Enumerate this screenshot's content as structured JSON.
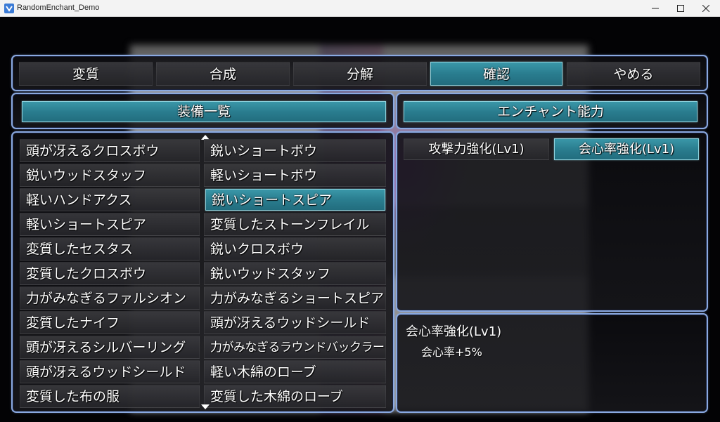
{
  "window": {
    "title": "RandomEnchant_Demo"
  },
  "command_menu": {
    "items": [
      {
        "label": "変質",
        "selected": false
      },
      {
        "label": "合成",
        "selected": false
      },
      {
        "label": "分解",
        "selected": false
      },
      {
        "label": "確認",
        "selected": true
      },
      {
        "label": "やめる",
        "selected": false
      }
    ]
  },
  "equipment_panel": {
    "header": "装備一覧"
  },
  "enchant_panel": {
    "header": "エンチャント能力"
  },
  "equipment_list": {
    "left": [
      "頭が冴えるクロスボウ",
      "鋭いウッドスタッフ",
      "軽いハンドアクス",
      "軽いショートスピア",
      "変質したセスタス",
      "変質したクロスボウ",
      "力がみなぎるファルシオン",
      "変質したナイフ",
      "頭が冴えるシルバーリング",
      "頭が冴えるウッドシールド",
      "変質した布の服"
    ],
    "right": [
      "鋭いショートボウ",
      "軽いショートボウ",
      "鋭いショートスピア",
      "変質したストーンフレイル",
      "鋭いクロスボウ",
      "鋭いウッドスタッフ",
      "力がみなぎるショートスピア",
      "頭が冴えるウッドシールド",
      "力がみなぎるラウンドバックラー",
      "軽い木綿のローブ",
      "変質した木綿のローブ"
    ],
    "selected": "鋭いショートスピア"
  },
  "enchantments": {
    "items": [
      {
        "label": "攻撃力強化(Lv1)",
        "selected": false
      },
      {
        "label": "会心率強化(Lv1)",
        "selected": true
      }
    ]
  },
  "help": {
    "title": "会心率強化(Lv1)",
    "effect": "会心率+5%"
  },
  "colors": {
    "frame_border": "#8aa9e0",
    "selection": "#2a7d8f",
    "text": "#ffffff"
  },
  "icons": [
    "app-icon",
    "minimize-icon",
    "maximize-icon",
    "close-icon",
    "scroll-up-icon",
    "scroll-down-icon"
  ]
}
